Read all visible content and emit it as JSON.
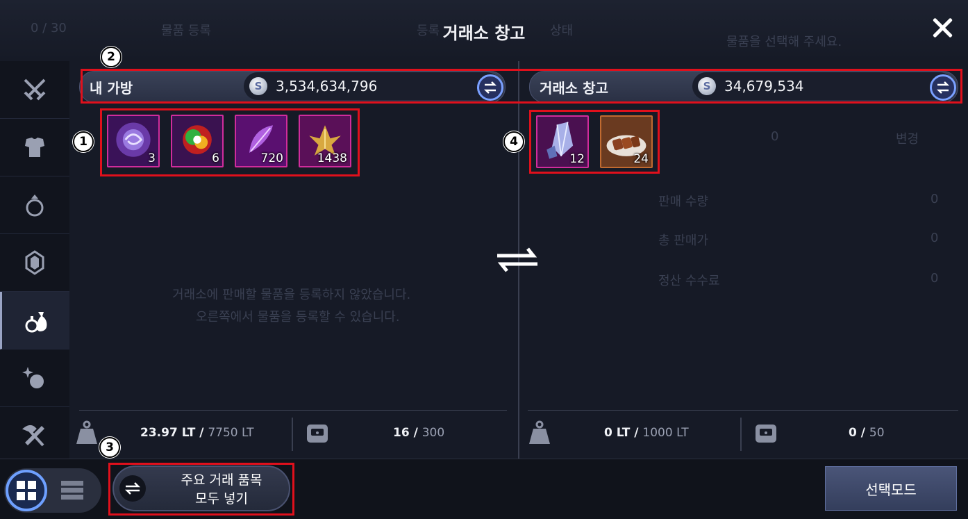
{
  "window": {
    "title": "거래소 창고",
    "close_icon": "close-icon"
  },
  "background_ghost": {
    "count": "0 / 30",
    "tab1": "물품 등록",
    "tab2": "등록",
    "tab3": "상태",
    "prompt": "물품을 선택해 주세요.",
    "zero": "0",
    "change": "변경",
    "sell_qty": "판매 수량",
    "total_price": "총 판매가",
    "fee": "정산 수수료",
    "v1": "0",
    "v2": "0",
    "v3": "0",
    "empty_line1": "거래소에 판매할 물품을 등록하지 않았습니다.",
    "empty_line2": "오른쪽에서 물품을 등록할 수 있습니다."
  },
  "sidebar": {
    "items": [
      {
        "icon": "crossed-swords-icon"
      },
      {
        "icon": "armor-icon"
      },
      {
        "icon": "ring-icon"
      },
      {
        "icon": "gem-icon"
      },
      {
        "icon": "potion-bag-icon",
        "active": true
      },
      {
        "icon": "orb-sparkle-icon"
      },
      {
        "icon": "tools-icon"
      }
    ]
  },
  "left_panel": {
    "label": "내 가방",
    "amount": "3,534,634,796",
    "items": [
      {
        "qty": "3",
        "icon": "purple-swirl-orb-icon"
      },
      {
        "qty": "6",
        "icon": "rainbow-orb-icon"
      },
      {
        "qty": "720",
        "icon": "purple-feather-icon"
      },
      {
        "qty": "1438",
        "icon": "golden-leaf-icon"
      }
    ],
    "weight_current": "23.97 LT",
    "weight_max": "7750 LT",
    "slots_current": "16",
    "slots_max": "300"
  },
  "right_panel": {
    "label": "거래소 창고",
    "amount": "34,679,534",
    "items": [
      {
        "qty": "12",
        "icon": "crystal-icon"
      },
      {
        "qty": "24",
        "icon": "grilled-meat-plate-icon"
      }
    ],
    "weight_current": "0 LT",
    "weight_max": "1000 LT",
    "slots_current": "0",
    "slots_max": "50"
  },
  "annotations": {
    "m1": "1",
    "m2": "2",
    "m3": "3",
    "m4": "4"
  },
  "bottom": {
    "add_all_line1": "주요 거래 품목",
    "add_all_line2": "모두 넣기",
    "select_mode": "선택모드"
  },
  "colors": {
    "accent": "#6ea0ff",
    "highlight": "#e0101c",
    "item_border": "#d02c9c"
  }
}
